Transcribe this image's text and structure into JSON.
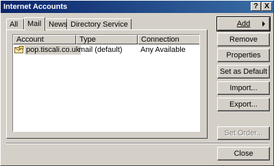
{
  "window": {
    "title": "Internet Accounts",
    "help_label": "?",
    "close_label": "X"
  },
  "tabs": [
    {
      "label": "All",
      "active": false
    },
    {
      "label": "Mail",
      "active": true
    },
    {
      "label": "News",
      "active": false
    },
    {
      "label": "Directory Service",
      "active": false
    }
  ],
  "accounts_list": {
    "columns": [
      "Account",
      "Type",
      "Connection"
    ],
    "rows": [
      {
        "account": "pop.tiscali.co.uk",
        "type": "mail (default)",
        "connection": "Any Available"
      }
    ]
  },
  "buttons": {
    "add": "Add",
    "remove": "Remove",
    "properties": "Properties",
    "set_as_default": "Set as Default",
    "import": "Import...",
    "export": "Export...",
    "set_order": "Set Order...",
    "close": "Close"
  },
  "icons": {
    "account": "mail-account-icon",
    "add_arrow": "arrow-right-icon"
  }
}
